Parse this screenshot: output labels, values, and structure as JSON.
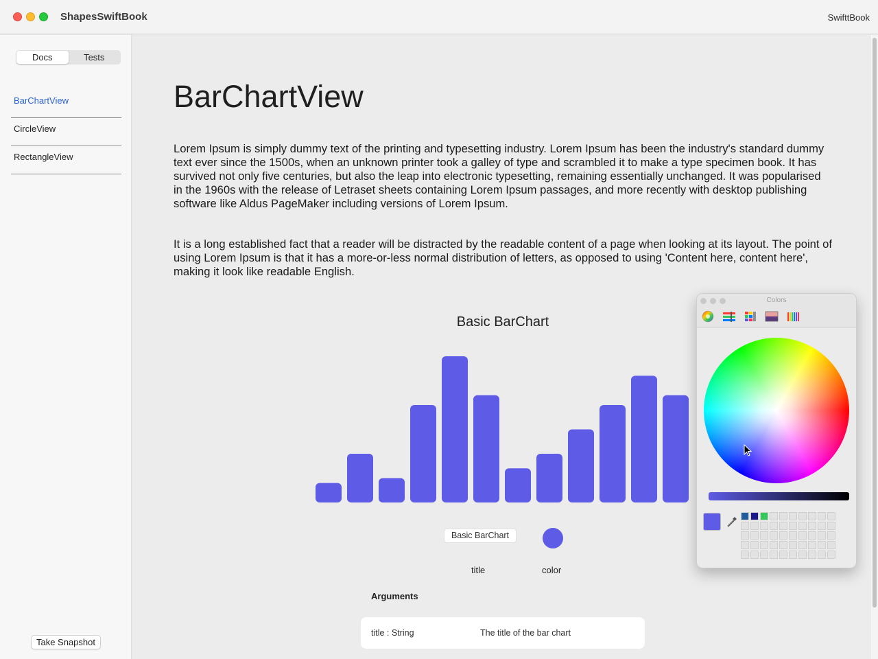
{
  "window": {
    "title": "ShapesSwiftBook",
    "right_label": "SwifttBook"
  },
  "sidebar": {
    "segments": [
      "Docs",
      "Tests"
    ],
    "active_segment": "Docs",
    "items": [
      {
        "label": "BarChartView",
        "selected": true
      },
      {
        "label": "CircleView",
        "selected": false
      },
      {
        "label": "RectangleView",
        "selected": false
      }
    ],
    "snapshot_label": "Take Snapshot"
  },
  "main": {
    "title": "BarChartView",
    "paragraph1": "Lorem Ipsum is simply dummy text of the printing and typesetting industry. Lorem Ipsum has been the industry's standard dummy text ever since the 1500s, when an unknown printer took a galley of type and scrambled it to make a type specimen book. It has survived not only five centuries, but also the leap into electronic typesetting, remaining essentially unchanged. It was popularised in the 1960s with the release of Letraset sheets containing Lorem Ipsum passages, and more recently with desktop publishing software like Aldus PageMaker including versions of Lorem Ipsum.",
    "paragraph2": "It is a long established fact that a reader will be distracted by the readable content of a page when looking at its layout. The point of using Lorem Ipsum is that it has a more-or-less normal distribution of letters, as opposed to using 'Content here, content here', making it look like readable English.",
    "arguments_heading": "Arguments",
    "arg_title_value": "Basic BarChart",
    "arg_labels": {
      "title": "title",
      "color": "color"
    },
    "arg_row": {
      "name": "title  :  String",
      "description": "The title of the bar chart"
    }
  },
  "chart_data": {
    "type": "bar",
    "title": "Basic BarChart",
    "values": [
      2,
      5,
      2.5,
      10,
      15,
      11,
      3.5,
      5,
      7.5,
      10,
      13,
      11
    ],
    "ylim": [
      0,
      15
    ],
    "color": "#5e5ce6",
    "grid": false,
    "legend": "none"
  },
  "colors_panel": {
    "title": "Colors",
    "modes": [
      "color-wheel",
      "color-sliders",
      "color-palettes",
      "image-palettes",
      "pencils"
    ],
    "current_color": "#5e5ce6",
    "custom_swatches": [
      "#1f5f9e",
      "#1a1a8c",
      "#34c759"
    ]
  }
}
